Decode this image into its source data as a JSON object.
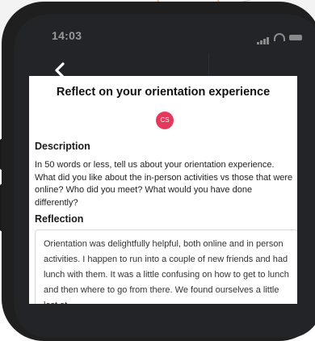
{
  "status": {
    "time": "14:03"
  },
  "page": {
    "title": "Reflect on your orientation experience",
    "avatar_initials": "CS"
  },
  "description": {
    "label": "Description",
    "text": "In 50 words or less, tell us about your orientation experience. What did you like about the in-person activities vs those that were online? Who did you meet? What would you have done differently?"
  },
  "reflection": {
    "label": "Reflection",
    "value": "Orientation was delightfully helpful, both online and in person activities. I happen to run into a couple of new friends and had lunch with them. It was a little confusing on how to get to lunch and then where to go from there. We found ourselves a little lost at"
  },
  "icons": {
    "back": "chevron-left-icon"
  },
  "colors": {
    "accent": "#e5395c",
    "phone_frame": "#1f1f1f",
    "screen_dark": "#222427"
  }
}
